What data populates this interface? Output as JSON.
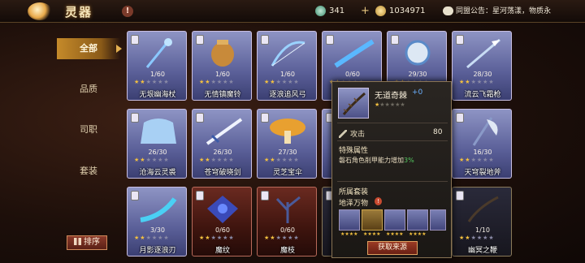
{
  "header": {
    "title": "灵器",
    "help_icon": "!",
    "jade": "341",
    "gold": "1034971",
    "notice": "同盟公告：星河荡漾，物质永"
  },
  "sidebar": {
    "tabs": [
      {
        "label": "全部"
      },
      {
        "label": "品质"
      },
      {
        "label": "司职"
      },
      {
        "label": "套装"
      }
    ],
    "sort_label": "排序"
  },
  "cards": [
    {
      "name": "无垠幽海杖",
      "count": "1/60",
      "theme": "blue",
      "art": "staff"
    },
    {
      "name": "无情镇魔铃",
      "count": "1/60",
      "theme": "blue",
      "art": "bell"
    },
    {
      "name": "逐浪追风弓",
      "count": "1/60",
      "theme": "blue",
      "art": "bow"
    },
    {
      "name": "",
      "count": "0/60",
      "theme": "blue",
      "art": "blade"
    },
    {
      "name": "",
      "count": "29/30",
      "theme": "blue",
      "art": "mirror"
    },
    {
      "name": "流云飞霜枪",
      "count": "28/30",
      "theme": "blue",
      "art": "spear"
    },
    {
      "name": "沧海云灵裘",
      "count": "26/30",
      "theme": "blue",
      "art": "robe"
    },
    {
      "name": "苍穹破晓剑",
      "count": "26/30",
      "theme": "blue",
      "art": "sword"
    },
    {
      "name": "灵芝宝伞",
      "count": "27/30",
      "theme": "blue",
      "art": "mushroom"
    },
    {
      "name": "",
      "count": "",
      "theme": "blue",
      "art": "none"
    },
    {
      "name": "",
      "count": "",
      "theme": "blue",
      "art": "none"
    },
    {
      "name": "天穹裂地斧",
      "count": "16/30",
      "theme": "blue",
      "art": "axe"
    },
    {
      "name": "月影逐浪刃",
      "count": "3/30",
      "theme": "blue",
      "art": "dagger"
    },
    {
      "name": "魔纹",
      "count": "0/60",
      "theme": "red",
      "art": "crest"
    },
    {
      "name": "魔枝",
      "count": "0/60",
      "theme": "red",
      "art": "branch"
    },
    {
      "name": "",
      "count": "",
      "theme": "dark",
      "art": "none"
    },
    {
      "name": "",
      "count": "",
      "theme": "dark",
      "art": "none"
    },
    {
      "name": "幽冥之鞭",
      "count": "1/10",
      "theme": "dark",
      "art": "whip"
    }
  ],
  "popup": {
    "name": "无道奇棘",
    "plus": "+0",
    "attack_label": "攻击",
    "attack_value": "80",
    "special_title": "特殊属性",
    "special_text": "磐石角色削甲能力增加",
    "special_value": "3%",
    "set_title": "所属套装",
    "set_name": "地泽万物",
    "set_warn": "!",
    "source_button": "获取来源"
  },
  "colors": {
    "accent": "#c58a2a",
    "card_blue": "#6a6fa8",
    "card_red": "#5a1e16"
  }
}
